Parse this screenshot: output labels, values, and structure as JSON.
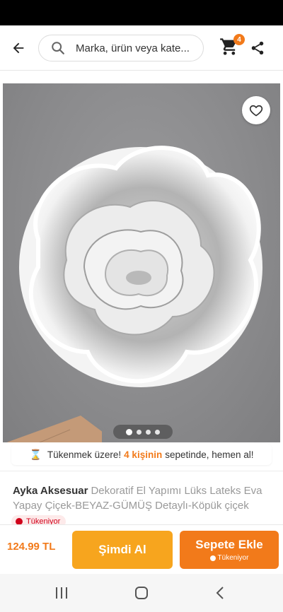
{
  "search": {
    "placeholder": "Marka, ürün veya kate..."
  },
  "header": {
    "cart_count": "4"
  },
  "gallery": {
    "image_count": 4,
    "active_index": 0
  },
  "urgency": {
    "prefix": "Tükenmek üzere!",
    "count": "4 kişinin",
    "suffix": "sepetinde, hemen al!"
  },
  "product": {
    "brand": "Ayka Aksesuar",
    "name": "Dekoratif El Yapımı Lüks Lateks Eva Yapay Çiçek-BEYAZ-GÜMÜŞ Detaylı-Köpük çiçek",
    "stock_status": "Tükeniyor"
  },
  "bottom_bar": {
    "price": "124.99 TL",
    "buy_now_label": "Şimdi Al",
    "add_to_cart_label": "Sepete Ekle",
    "add_to_cart_sub": "Tükeniyor"
  },
  "colors": {
    "accent": "#f27a1a",
    "buy_now": "#f7a51e",
    "stock_red": "#d0021b"
  },
  "icons": [
    "back-arrow-icon",
    "search-icon",
    "cart-icon",
    "share-icon",
    "heart-icon",
    "hourglass-icon",
    "recent-apps-icon",
    "home-icon",
    "back-nav-icon"
  ]
}
